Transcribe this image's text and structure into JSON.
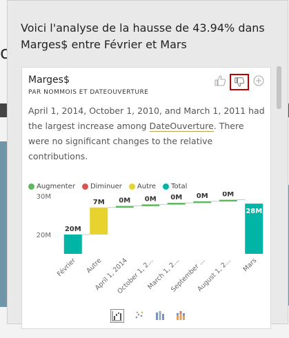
{
  "panel": {
    "title": "Voici l'analyse de la hausse de 43.94% dans Marges$ entre Février et Mars"
  },
  "card": {
    "title": "Marges$",
    "subtitle": "PAR NOMMOIS ET DATEOUVERTURE",
    "text_before": "April 1, 2014, October 1, 2010, and March 1, 2011 had the largest increase among ",
    "text_link": "DateOuverture",
    "text_after": ". There were no significant changes to the relative contributions.",
    "actions": {
      "like_icon": "thumbs-up-icon",
      "dislike_icon": "thumbs-down-icon",
      "add_icon": "add-circle-icon"
    }
  },
  "legend": [
    {
      "label": "Augmenter",
      "color": "#5cb85c"
    },
    {
      "label": "Diminuer",
      "color": "#d9534f"
    },
    {
      "label": "Autre",
      "color": "#e8d22e"
    },
    {
      "label": "Total",
      "color": "#00b5a6"
    }
  ],
  "chart_data": {
    "type": "bar",
    "subtype": "waterfall",
    "categories": [
      "Février",
      "Autre",
      "April 1, 2014",
      "October 1, 2...",
      "March 1, 2...",
      "September ...",
      "August 1, 2...",
      "Mars"
    ],
    "values": [
      20,
      7,
      0.4,
      0.4,
      0.4,
      0.4,
      0.4,
      28
    ],
    "value_labels": [
      "20M",
      "7M",
      "0M",
      "0M",
      "0M",
      "0M",
      "0M",
      "28M"
    ],
    "kinds": [
      "total",
      "other",
      "increase",
      "increase",
      "increase",
      "increase",
      "increase",
      "total"
    ],
    "y_ticks": [
      "30M",
      "20M"
    ],
    "y_tick_values": [
      30,
      20
    ],
    "ylim": [
      15,
      30
    ],
    "colors": {
      "increase": "#5cb85c",
      "decrease": "#d9534f",
      "other": "#e8d22e",
      "total": "#00b5a6"
    }
  },
  "viz_buttons": [
    {
      "name": "waterfall-chart-icon"
    },
    {
      "name": "scatter-chart-icon"
    },
    {
      "name": "column-chart-icon"
    },
    {
      "name": "stacked-column-chart-icon"
    }
  ]
}
